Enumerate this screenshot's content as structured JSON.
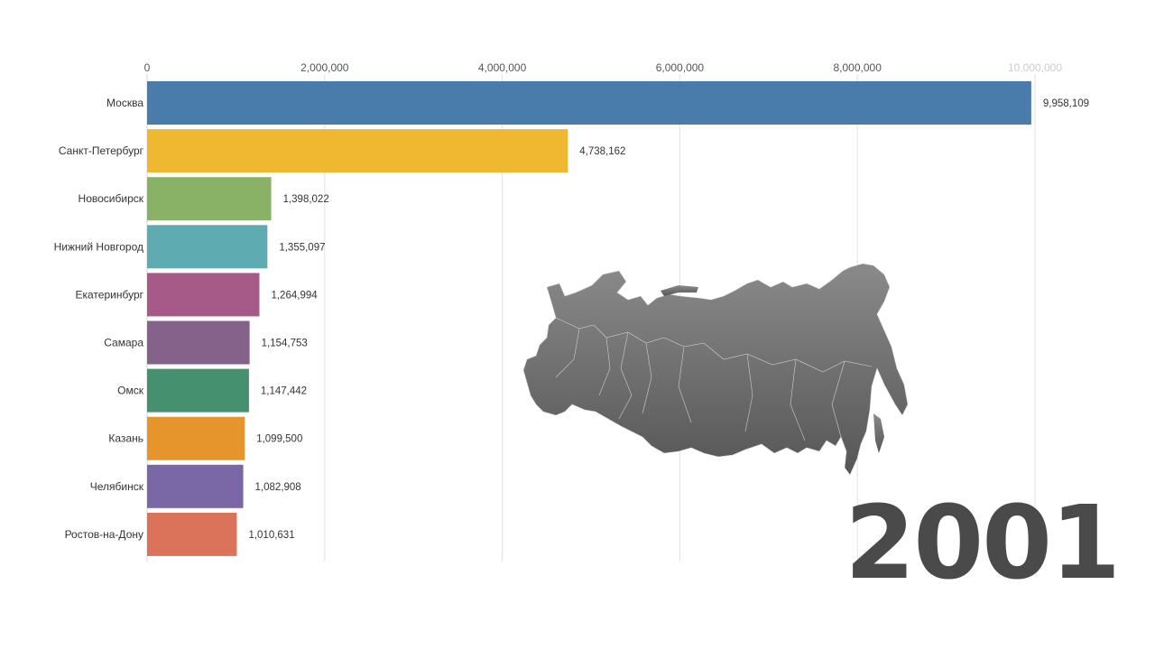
{
  "chart_data": {
    "type": "bar",
    "orientation": "horizontal",
    "year": "2001",
    "categories": [
      "Москва",
      "Санкт-Петербург",
      "Новосибирск",
      "Нижний Новгород",
      "Екатеринбург",
      "Самара",
      "Омск",
      "Казань",
      "Челябинск",
      "Ростов-на-Дону"
    ],
    "values": [
      9958109,
      4738162,
      1398022,
      1355097,
      1264994,
      1154753,
      1147442,
      1099500,
      1082908,
      1010631
    ],
    "value_labels": [
      "9,958,109",
      "4,738,162",
      "1,398,022",
      "1,355,097",
      "1,264,994",
      "1,154,753",
      "1,147,442",
      "1,099,500",
      "1,082,908",
      "1,010,631"
    ],
    "colors": [
      "#4a7cab",
      "#f0b730",
      "#89b266",
      "#5fabb2",
      "#a65a88",
      "#85628a",
      "#45906e",
      "#e6942c",
      "#7a67a6",
      "#da735a"
    ],
    "xlim": [
      0,
      10000000
    ],
    "ticks": [
      0,
      2000000,
      4000000,
      6000000,
      8000000,
      10000000
    ],
    "tick_labels": [
      "0",
      "2,000,000",
      "4,000,000",
      "6,000,000",
      "8,000,000",
      "10,000,000"
    ],
    "grid": true,
    "axis_position": "top",
    "title": "",
    "xlabel": "",
    "ylabel": ""
  },
  "decoration": {
    "map": "russia-regions-map",
    "map_color": "#6b6b6b"
  }
}
